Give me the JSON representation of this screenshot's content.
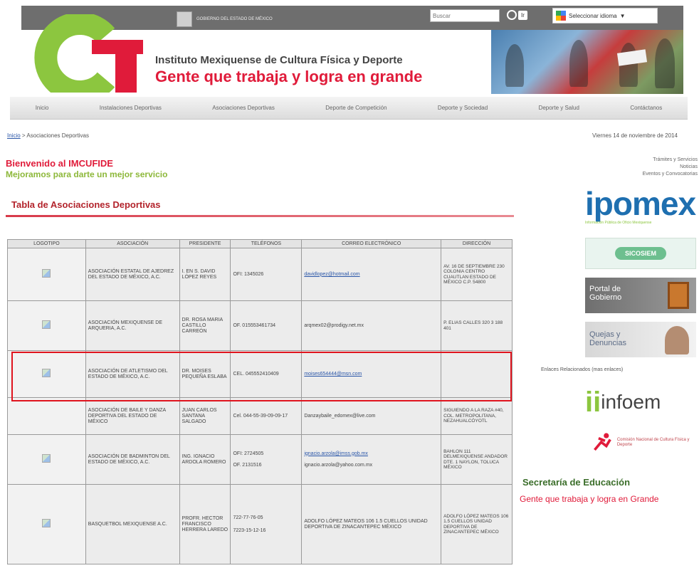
{
  "header": {
    "gov_logo_text": "GOBIERNO DEL ESTADO DE MÉXICO",
    "search_placeholder": "Buscar",
    "search_button": "Ir",
    "language_select": "Seleccionar idioma",
    "institute": "Instituto Mexiquense de Cultura Física y Deporte",
    "slogan": "Gente que trabaja y logra en grande"
  },
  "nav": {
    "items": [
      {
        "label": "Inicio"
      },
      {
        "label": "Instalaciones Deportivas"
      },
      {
        "label": "Asociaciones Deportivas"
      },
      {
        "label": "Deporte de Competición"
      },
      {
        "label": "Deporte y Sociedad"
      },
      {
        "label": "Deporte y Salud"
      },
      {
        "label": "Contáctanos"
      }
    ]
  },
  "breadcrumb": {
    "home": "Inicio",
    "separator": " > ",
    "current": "Asociaciones Deportivas"
  },
  "date": "Viernes 14 de noviembre de 2014",
  "welcome": {
    "title": "Bienvenido al IMCUFIDE",
    "subtitle": "Mejoramos para darte un mejor servicio"
  },
  "section": {
    "title": "Tabla de Asociaciones Deportivas"
  },
  "table": {
    "headers": [
      "LOGOTIPO",
      "ASOCIACIÓN",
      "PRESIDENTE",
      "TELÉFONOS",
      "CORREO ELECTRÓNICO",
      "DIRECCIÓN"
    ],
    "rows": [
      {
        "asociacion": "ASOCIACIÓN ESTATAL DE AJEDREZ DEL ESTADO DE MÉXICO, A.C.",
        "presidente": "I. EN S. DAVID LÓPEZ REYES",
        "telefonos": [
          "OFI: 1345026"
        ],
        "correo": [
          "davidlopez@hotmail.com"
        ],
        "direccion": "AV. 16 DE SEPTIEMBRE 230 COLONIA CENTRO CUAUTLAN ESTADO DE MÉXICO C.P. 54800"
      },
      {
        "asociacion": "ASOCIACIÓN MEXIQUENSE DE ARQUERIA, A.C.",
        "presidente": "DR. ROSA MARIA CASTILLO CARREÓN",
        "telefonos": [
          "OF. 015553461734"
        ],
        "correo": [
          "arqmex02@prodigy.net.mx"
        ],
        "direccion": "P. ELIAS CALLES 320 3 188 401"
      },
      {
        "asociacion": "ASOCIACIÓN DE ATLETISMO DEL ESTADO DE MÉXICO, A.C.",
        "presidente": "DR. MOISES PEQUEÑA ESLABA",
        "telefonos": [
          "CEL. 045552410409"
        ],
        "correo": [
          "moises654444@msn.com"
        ],
        "direccion": ""
      },
      {
        "asociacion": "ASOCIACIÓN DE BAILE Y DANZA DEPORTIVA DEL ESTADO DE MÉXICO",
        "presidente": "JUAN CARLOS SANTANA SALGADO",
        "telefonos": [
          "Cel. 044-55-39-09-09-17"
        ],
        "correo": [
          "Danzaybaile_edomex@live.com"
        ],
        "direccion": "SIGUIENDO A LA RAZA #40, COL. METROPOLITANA, NEZAHUALCÓYOTL"
      },
      {
        "asociacion": "ASOCIACIÓN DE BADMINTON DEL ESTADO DE MÉXICO, A.C.",
        "presidente": "ING. IGNACIO ARDOLA ROMERO",
        "telefonos": [
          "OFI: 2724505",
          "OF. 2131516"
        ],
        "correo": [
          "ignacio.arzola@imss.gob.mx",
          "ignacio.arzola@yahoo.com.mx"
        ],
        "direccion": "BAHLON 111 DELMEXIQUENSE ANDADOR DTE. 1 NAYLON, TOLUCA MÉXICO"
      },
      {
        "asociacion": "BASQUETBOL MEXIQUENSE A.C.",
        "presidente": "PROFR. HECTOR FRANCISCO HERRERA LAREDO",
        "telefonos": [
          "722-77-76-05",
          "7223-15-12-16"
        ],
        "correo": [
          "ADOLFO LÓPEZ MATEOS 106 1.5 CUELLOS UNIDAD DEPORTIVA DE ZINACANTEPEC MÉXICO"
        ],
        "direccion": "ADOLFO LÓPEZ MATEOS 106 1.5 CUELLOS UNIDAD DEPORTIVA DE ZINACANTEPEC MÉXICO"
      }
    ]
  },
  "sidebar": {
    "links": [
      "Trámites y Servicios",
      "Noticias",
      "Eventos y Convocatorias"
    ],
    "ipomex": "ipomex",
    "ipomex_caption": "Información Pública de Oficio Mexiquense",
    "sicosiem": "SICOSIEM",
    "portal": "Portal de Gobierno",
    "quejas": "Quejas y Denuncias",
    "related": "Enlaces Relacionados (mas enlaces)",
    "infoem": "infoem",
    "conade": "Comisión Nacional de Cultura Física y Deporte",
    "conade_short": "CONADE",
    "sep_title": "Secretaría de Educación",
    "sep_sub": "Gente que trabaja y logra en Grande"
  },
  "colors": {
    "brand_red": "#e01b3a",
    "brand_green": "#8db83a",
    "highlight": "#e0141e"
  }
}
